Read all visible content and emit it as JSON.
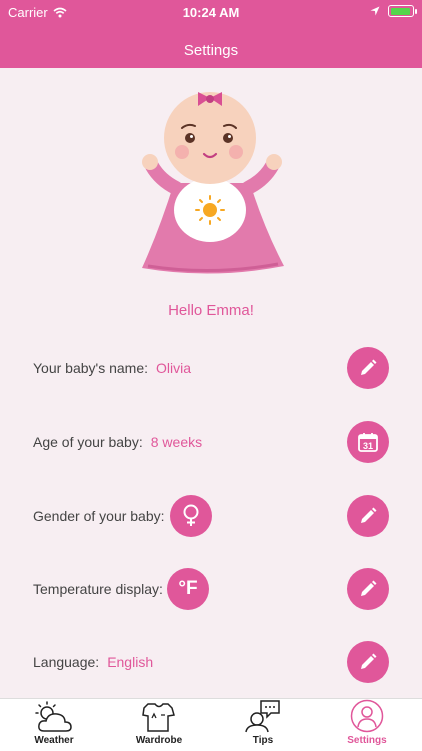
{
  "status_bar": {
    "carrier": "Carrier",
    "time": "10:24 AM"
  },
  "header": {
    "title": "Settings"
  },
  "greeting": "Hello Emma!",
  "rows": [
    {
      "label": "Your baby's name:",
      "value": "Olivia",
      "button_icon": "pencil-icon"
    },
    {
      "label": "Age of your baby:",
      "value": "8 weeks",
      "button_icon": "calendar-icon",
      "calendar_day": "31"
    },
    {
      "label": "Gender of your baby:",
      "value": "female",
      "button_icon": "pencil-icon"
    },
    {
      "label": "Temperature display:",
      "value": "°F",
      "button_icon": "pencil-icon"
    },
    {
      "label": "Language:",
      "value": "English",
      "button_icon": "pencil-icon"
    }
  ],
  "tabs": [
    {
      "label": "Weather",
      "icon": "weather-icon",
      "active": false
    },
    {
      "label": "Wardrobe",
      "icon": "wardrobe-icon",
      "active": false
    },
    {
      "label": "Tips",
      "icon": "tips-icon",
      "active": false
    },
    {
      "label": "Settings",
      "icon": "settings-icon",
      "active": true
    }
  ],
  "colors": {
    "accent": "#e0579a",
    "background": "#f7eef2"
  }
}
